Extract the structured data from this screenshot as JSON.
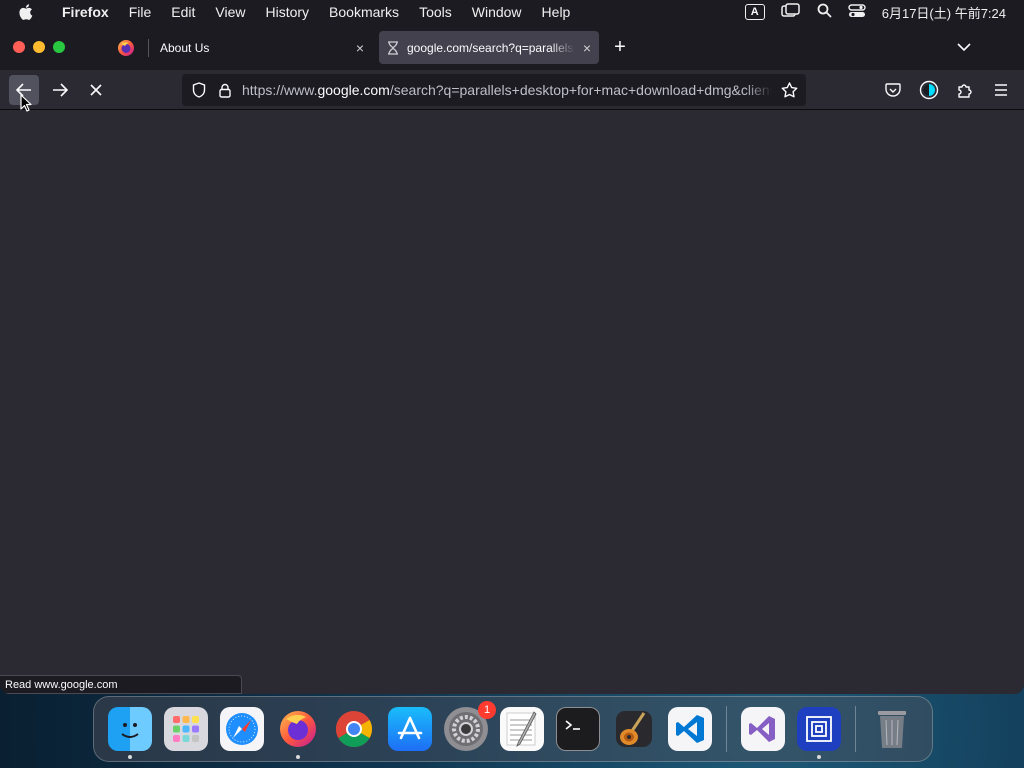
{
  "menubar": {
    "app_name": "Firefox",
    "items": [
      "File",
      "Edit",
      "View",
      "History",
      "Bookmarks",
      "Tools",
      "Window",
      "Help"
    ],
    "input_indicator": "A",
    "clock": "6月17日(土) 午前7:24"
  },
  "browser": {
    "tabs": [
      {
        "title": "About Us",
        "close": "×"
      },
      {
        "title": "google.com/search?q=parallels+desktop+for+mac+download+dmg&client=firefox",
        "close": "×",
        "active": true
      }
    ],
    "new_tab": "+",
    "url": {
      "prefix": "https://www.",
      "domain": "google.com",
      "path": "/search?q=parallels+desktop+for+mac+download+dmg&client=firefox-b-d"
    },
    "status_text": "Read www.google.com"
  },
  "dock": {
    "items": [
      {
        "name": "Finder",
        "icon": "finder-icon",
        "running": true
      },
      {
        "name": "Launchpad",
        "icon": "launchpad-icon"
      },
      {
        "name": "Safari",
        "icon": "safari-icon"
      },
      {
        "name": "Firefox",
        "icon": "firefox-icon",
        "running": true
      },
      {
        "name": "Google Chrome",
        "icon": "chrome-icon"
      },
      {
        "name": "App Store",
        "icon": "app-store-icon"
      },
      {
        "name": "System Settings",
        "icon": "settings-icon",
        "badge": "1"
      },
      {
        "name": "TextEdit",
        "icon": "textedit-icon"
      },
      {
        "name": "Terminal",
        "icon": "terminal-icon"
      },
      {
        "name": "GarageBand",
        "icon": "garageband-icon"
      },
      {
        "name": "Visual Studio Code",
        "icon": "vscode-icon"
      },
      {
        "name": "Visual Studio",
        "icon": "visual-studio-icon"
      },
      {
        "name": "Parallels",
        "icon": "parallels-icon",
        "running": true
      },
      {
        "name": "Trash",
        "icon": "trash-icon"
      }
    ]
  },
  "colors": {
    "window_bg": "#2b2a33",
    "toolbar_dark": "#1c1b22",
    "active_tab": "#42414d",
    "badge": "#ff3b30"
  }
}
